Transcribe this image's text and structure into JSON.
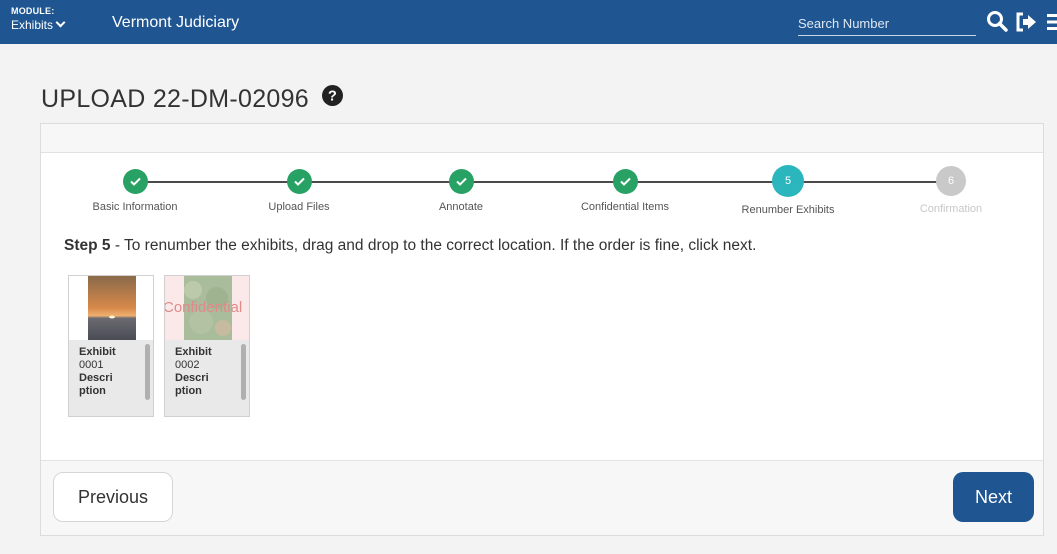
{
  "header": {
    "module_label": "MODULE:",
    "module_value": "Exhibits",
    "app_title": "Vermont Judiciary",
    "search_placeholder": "Search Number"
  },
  "page": {
    "title": "UPLOAD 22-DM-02096"
  },
  "colors": {
    "brand": "#1f5591",
    "step_done": "#27a264",
    "step_active": "#2bb6bd",
    "step_pending": "#c9c9c9"
  },
  "stepper": {
    "steps": [
      {
        "label": "Basic Information",
        "number": "",
        "status": "done"
      },
      {
        "label": "Upload Files",
        "number": "",
        "status": "done"
      },
      {
        "label": "Annotate",
        "number": "",
        "status": "done"
      },
      {
        "label": "Confidential Items",
        "number": "",
        "status": "done"
      },
      {
        "label": "Renumber Exhibits",
        "number": "5",
        "status": "active"
      },
      {
        "label": "Confirmation",
        "number": "6",
        "status": "pending"
      }
    ]
  },
  "instruction": {
    "step": "Step 5",
    "text": " - To renumber the exhibits, drag and drop to the correct location. If the order is fine, click next."
  },
  "exhibits": [
    {
      "label": "Exhibit",
      "number": "0001",
      "desc1": "Descri",
      "desc2": "ption",
      "overlay": ""
    },
    {
      "label": "Exhibit",
      "number": "0002",
      "desc1": "Descri",
      "desc2": "ption",
      "overlay": "Confidential"
    }
  ],
  "buttons": {
    "previous": "Previous",
    "next": "Next"
  }
}
